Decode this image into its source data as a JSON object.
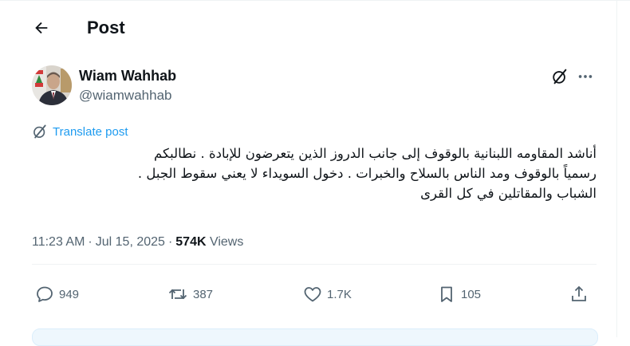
{
  "header": {
    "title": "Post"
  },
  "author": {
    "name": "Wiam Wahhab",
    "handle": "@wiamwahhab"
  },
  "translate": {
    "label": "Translate post"
  },
  "post": {
    "lines": [
      "أناشد المقاومه اللبنانية بالوقوف إلى جانب الدروز الذين يتعرضون للإبادة . نطالبكم",
      "رسمياً بالوقوف ومد الناس بالسلاح والخبرات . دخول السويداء لا يعني سقوط الجبل .",
      "الشباب والمقاتلين في كل القرى"
    ]
  },
  "meta": {
    "time": "11:23 AM",
    "date": "Jul 15, 2025",
    "views_count": "574K",
    "views_label": "Views"
  },
  "actions": {
    "replies": "949",
    "reposts": "387",
    "likes": "1.7K",
    "bookmarks": "105"
  },
  "colors": {
    "accent": "#1d9bf0",
    "text": "#0f1419",
    "muted": "#536471"
  }
}
